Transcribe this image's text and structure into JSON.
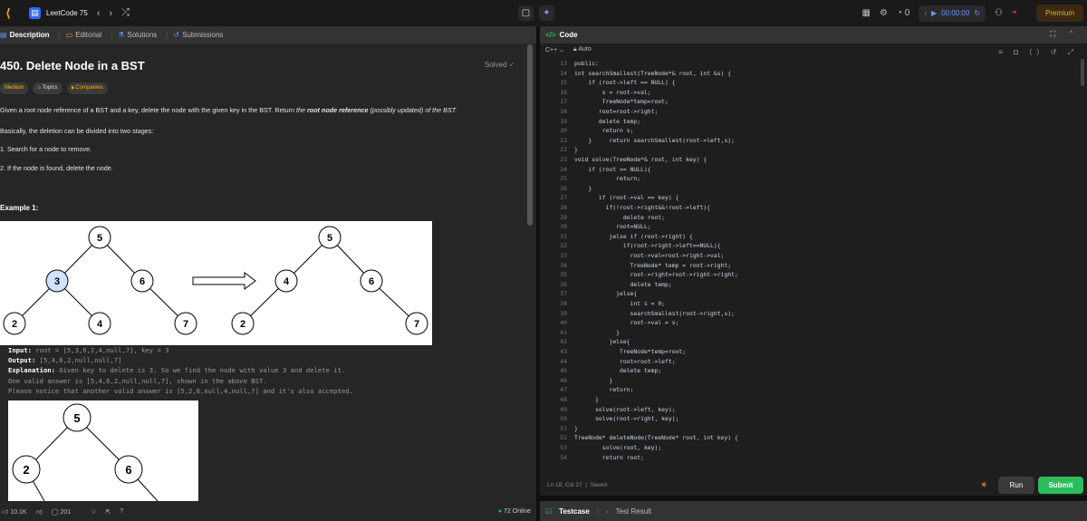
{
  "top": {
    "list_name": "LeetCode 75",
    "streak": "0",
    "timer": "00:00:00",
    "premium": "Premium"
  },
  "left": {
    "tabs": [
      "Description",
      "Editorial",
      "Solutions",
      "Submissions"
    ],
    "title": "450. Delete Node in a BST",
    "solved": "Solved",
    "chips": [
      "Medium",
      "Topics",
      "Companies"
    ],
    "desc1_pre": "Given a root node reference of a BST and a key, delete the node with the given key in the BST. Return ",
    "desc1_em": "the ",
    "desc1_bold": "root node reference",
    "desc1_post": " (possibly updated) of the BST.",
    "desc2": "Basically, the deletion can be divided into two stages:",
    "step1": "1. Search for a node to remove.",
    "step2": "2. If the node is found, delete the node.",
    "example1": "Example 1:",
    "input_label": "Input:",
    "input_val": " root = [5,3,6,2,4,null,7], key = 3",
    "output_label": "Output:",
    "output_val": " [5,4,6,2,null,null,7]",
    "expl_label": "Explanation:",
    "expl_val": " Given key to delete is 3. So we find the node with value 3 and delete it.",
    "expl2": "One valid answer is [5,4,6,2,null,null,7], shown in the above BST.",
    "expl3": "Please notice that another valid answer is [5,2,6,null,4,null,7] and it's also accepted.",
    "tree1_before": [
      "5",
      "3",
      "6",
      "2",
      "4",
      "7"
    ],
    "tree1_after": [
      "5",
      "4",
      "6",
      "2",
      "7"
    ],
    "tree2": [
      "5",
      "2",
      "6"
    ],
    "likes": "10.1K",
    "comments": "201",
    "online": "72 Online"
  },
  "right": {
    "header": "Code",
    "language": "C++",
    "auto": "Auto",
    "status": "Ln 18, Col 27",
    "saved": "Saved",
    "run": "Run",
    "submit": "Submit",
    "bottom_tabs": [
      "Testcase",
      "Test Result"
    ],
    "code": [
      {
        "n": "13",
        "t": "public:"
      },
      {
        "n": "14",
        "t": "int searchSmallest(TreeNode*& root, int &s) {"
      },
      {
        "n": "15",
        "t": "    if (root->left == NULL) {"
      },
      {
        "n": "16",
        "t": "        s = root->val;"
      },
      {
        "n": "17",
        "t": "        TreeNode*temp=root;"
      },
      {
        "n": "18",
        "t": "       root=root->right;"
      },
      {
        "n": "19",
        "t": "       delete temp;"
      },
      {
        "n": "20",
        "t": "        return s;"
      },
      {
        "n": "21",
        "t": "    }     return searchSmallest(root->left,s);"
      },
      {
        "n": "22",
        "t": "}"
      },
      {
        "n": "23",
        "t": "void solve(TreeNode*& root, int key) {"
      },
      {
        "n": "24",
        "t": "    if (root == NULL){"
      },
      {
        "n": "25",
        "t": "            return;"
      },
      {
        "n": "26",
        "t": "    }"
      },
      {
        "n": "27",
        "t": "       if (root->val == key) {"
      },
      {
        "n": "28",
        "t": "         if(!root->right&&!root->left){"
      },
      {
        "n": "29",
        "t": "              delete root;"
      },
      {
        "n": "30",
        "t": "            root=NULL;"
      },
      {
        "n": "31",
        "t": "          }else if (root->right) {"
      },
      {
        "n": "32",
        "t": "              if(root->right->left==NULL){"
      },
      {
        "n": "33",
        "t": "                root->val=root->right->val;"
      },
      {
        "n": "34",
        "t": "                TreeNode* temp = root->right;"
      },
      {
        "n": "35",
        "t": "                root->right=root->right->right;"
      },
      {
        "n": "36",
        "t": "                delete temp;"
      },
      {
        "n": "37",
        "t": "            }else{"
      },
      {
        "n": "38",
        "t": "                int s = 0;"
      },
      {
        "n": "39",
        "t": "                searchSmallest(root->right,s);"
      },
      {
        "n": "40",
        "t": "                root->val = s;"
      },
      {
        "n": "41",
        "t": "            }"
      },
      {
        "n": "42",
        "t": "          }else{"
      },
      {
        "n": "43",
        "t": "             TreeNode*temp=root;"
      },
      {
        "n": "44",
        "t": "             root=root->left;"
      },
      {
        "n": "45",
        "t": "             delete temp;"
      },
      {
        "n": "46",
        "t": "          }"
      },
      {
        "n": "47",
        "t": "          return;"
      },
      {
        "n": "48",
        "t": "      }"
      },
      {
        "n": "49",
        "t": "      solve(root->left, key);"
      },
      {
        "n": "50",
        "t": "      solve(root->right, key);"
      },
      {
        "n": "51",
        "t": "}"
      },
      {
        "n": "52",
        "t": "TreeNode* deleteNode(TreeNode* root, int key) {"
      },
      {
        "n": "53",
        "t": "        solve(root, key);"
      },
      {
        "n": "54",
        "t": "        return root;"
      }
    ]
  }
}
